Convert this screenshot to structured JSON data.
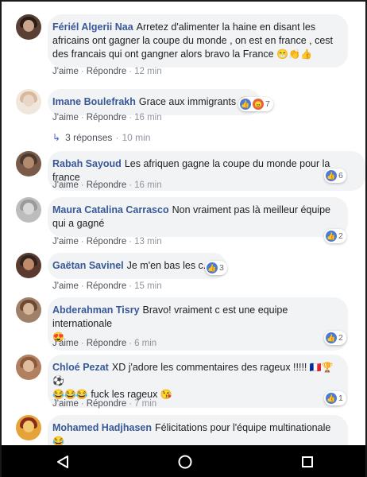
{
  "comments": [
    {
      "author": "Fériél Algerii Naa",
      "text": "Arretez d'alimenter la haine en disant les africains ont gagner la coupe du monde , on est en france , cest des francais qui ont gangner alors bravo la France",
      "emojis": "😁👏👍",
      "like": "J'aime",
      "reply": "Répondre",
      "time": "12 min",
      "avatar_colors": [
        "#c9a58c",
        "#3b2a24"
      ]
    },
    {
      "author": "Imane Boulefrakh",
      "text": "Grace aux immigrants",
      "emojis": "😂",
      "like": "J'aime",
      "reply": "Répondre",
      "time": "16 min",
      "reaction_count": "7",
      "replies_label": "3 réponses",
      "replies_time": "10 min",
      "avatar_colors": [
        "#e8d6c8",
        "#d9b89c"
      ]
    },
    {
      "author": "Rabah Sayoud",
      "text": "Les afriquen gagne la coupe du monde pour la france",
      "like": "J'aime",
      "reply": "Répondre",
      "time": "16 min",
      "reaction_count": "6",
      "avatar_colors": [
        "#b48a6e",
        "#4a3a30"
      ]
    },
    {
      "author": "Maura Catalina Carrasco",
      "text": "Non vraiment pas là meilleur équipe qui a gagné",
      "like": "J'aime",
      "reply": "Répondre",
      "time": "13 min",
      "reaction_count": "2",
      "avatar_colors": [
        "#d8d8d8",
        "#9a9a9a"
      ]
    },
    {
      "author": "Gaëtan Savinel",
      "text": "Je m'en bas les c.....",
      "like": "J'aime",
      "reply": "Répondre",
      "time": "15 min",
      "reaction_count": "3",
      "avatar_colors": [
        "#c08a6a",
        "#2e2420"
      ]
    },
    {
      "author": "Abderahman Tisry",
      "text": "Bravo! vraiment c est une equipe internationale",
      "emojis": "😍",
      "like": "J'aime",
      "reply": "Répondre",
      "time": "6 min",
      "reaction_count": "2",
      "avatar_colors": [
        "#d7b79c",
        "#6b4a33"
      ]
    },
    {
      "author": "Chloé Pezat",
      "text": "XD j'adore les commentaires des rageux !!!!!",
      "emojis": "🇫🇷🏆⚽",
      "text2_emojis": "😂😂😂",
      "text2": "fuck les rageux",
      "text2_end": "😘",
      "like": "J'aime",
      "reply": "Répondre",
      "time": "7 min",
      "reaction_count": "1",
      "avatar_colors": [
        "#e0bba0",
        "#8a5a3a"
      ]
    },
    {
      "author": "Mohamed Hadjhasen",
      "text": "Félicitations pour l'équipe multinationale",
      "emojis": "😂",
      "text2_emojis": "😂😂",
      "avatar_colors": [
        "#e5a33a",
        "#8a2a1a"
      ]
    }
  ],
  "nav": {
    "back_icon": "back-triangle-icon",
    "home_icon": "home-circle-icon",
    "recents_icon": "recents-square-icon"
  },
  "colors": {
    "author": "#385898",
    "bubble": "#f2f3f5",
    "like_blue": "#4a7bd6"
  }
}
